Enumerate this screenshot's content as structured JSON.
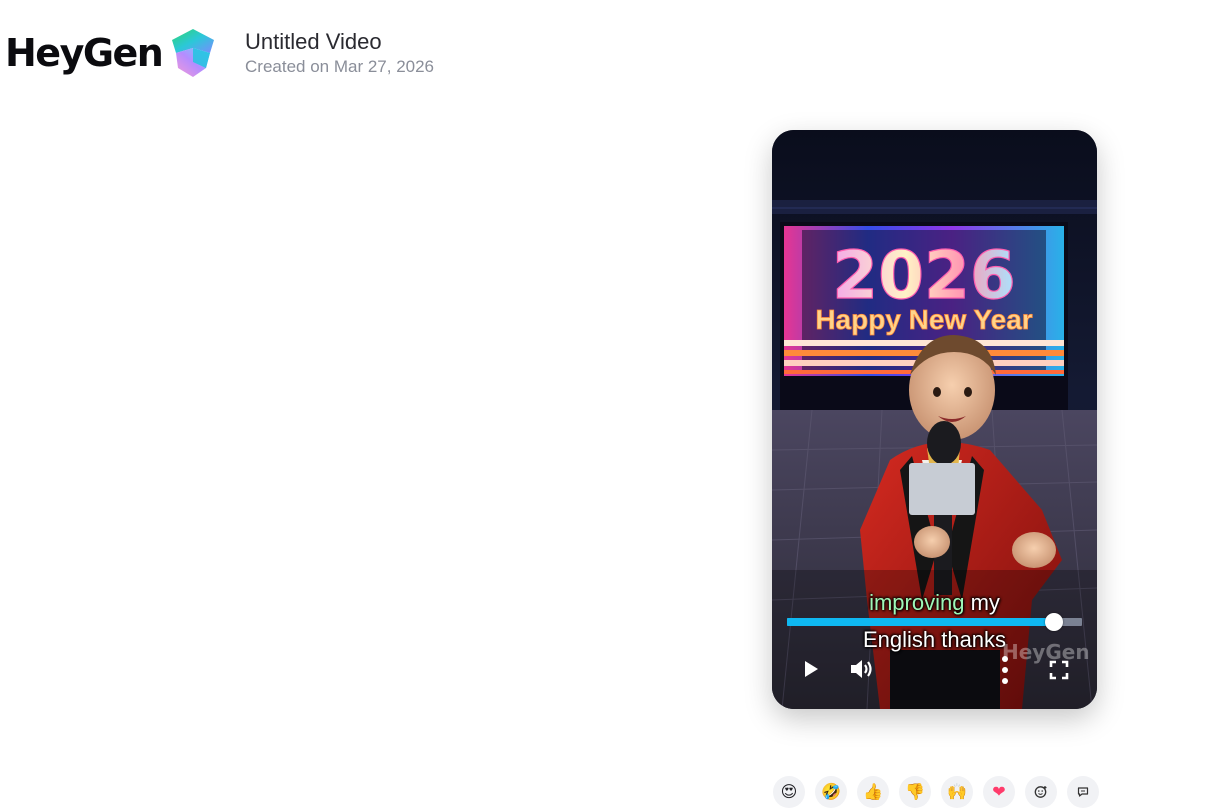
{
  "brand": {
    "name": "HeyGen"
  },
  "video": {
    "title": "Untitled Video",
    "created": "Created on Mar 27, 2026",
    "scene_text": {
      "year": "2026",
      "banner": "Happy New Year"
    },
    "captions": {
      "line1_highlight": "improving",
      "line1_rest": " my",
      "line2": "English thanks"
    },
    "watermark": "HeyGen",
    "progress": 0.905,
    "colors": {
      "progress": "#0fb8f2",
      "caption_highlight": "#9ef7b8"
    }
  },
  "controls": {
    "play": {
      "icon": "play-icon"
    },
    "volume": {
      "icon": "volume-icon"
    },
    "more": {
      "icon": "more-vertical-icon"
    },
    "fullscreen": {
      "icon": "fullscreen-icon"
    }
  },
  "reactions": [
    {
      "name": "heart-eyes-emoji",
      "glyph": "😍"
    },
    {
      "name": "rofl-emoji",
      "glyph": "🤣"
    },
    {
      "name": "thumbs-up-emoji",
      "glyph": "👍"
    },
    {
      "name": "thumbs-down-emoji",
      "glyph": "👎"
    },
    {
      "name": "raising-hands-emoji",
      "glyph": "🙌"
    },
    {
      "name": "heart-emoji",
      "glyph": "❤"
    },
    {
      "name": "add-reaction-icon",
      "glyph": ""
    },
    {
      "name": "comment-icon",
      "glyph": ""
    }
  ]
}
